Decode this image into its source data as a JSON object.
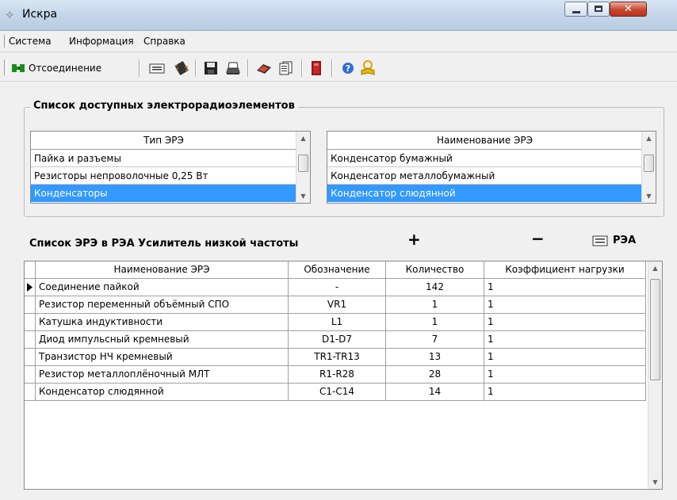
{
  "window": {
    "title": "Искра"
  },
  "menu": [
    "Система",
    "Информация",
    "Справка"
  ],
  "toolbar": {
    "disconnect_label": "Отсоединение"
  },
  "available": {
    "group_title": "Список доступных электрорадиоэлементов",
    "types": {
      "header": "Тип ЭРЭ",
      "rows": [
        "Пайка и разъемы",
        "Резисторы непроволочные 0,25 Вт",
        "Конденсаторы"
      ],
      "selected_index": 2
    },
    "names": {
      "header": "Наименование ЭРЭ",
      "rows": [
        "Конденсатор бумажный",
        "Конденсатор металлобумажный",
        "Конденсатор слюдянной"
      ],
      "selected_index": 2
    }
  },
  "rea_list": {
    "title": "Список ЭРЭ в РЭА Усилитель низкой частоты",
    "add_label": "+",
    "remove_label": "−",
    "rea_label": "РЭА",
    "columns": [
      "Наименование ЭРЭ",
      "Обозначение",
      "Количество",
      "Коэффициент нагрузки"
    ],
    "rows": [
      [
        "Соединение пайкой",
        "-",
        "142",
        "1"
      ],
      [
        "Резистор переменный объёмный СПО",
        "VR1",
        "1",
        "1"
      ],
      [
        "Катушка индуктивности",
        "L1",
        "1",
        "1"
      ],
      [
        "Диод импульсный кремневый",
        "D1-D7",
        "7",
        "1"
      ],
      [
        "Транзистор НЧ кремневый",
        "TR1-TR13",
        "13",
        "1"
      ],
      [
        "Резистор металлоплёночный МЛТ",
        "R1-R28",
        "28",
        "1"
      ],
      [
        "Конденсатор слюдянной",
        "C1-C14",
        "14",
        "1"
      ]
    ],
    "current_row": 0
  }
}
